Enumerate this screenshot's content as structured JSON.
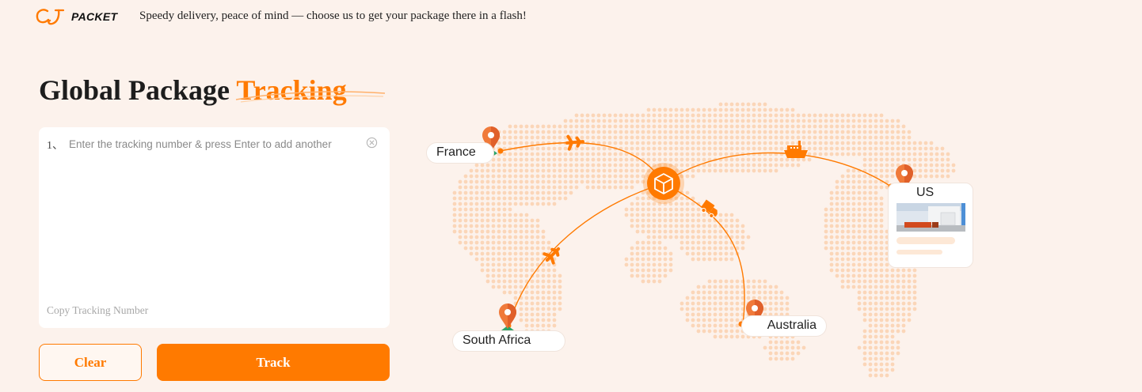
{
  "header": {
    "logo_text": "PACKET",
    "logo_icon": "cj-logo-icon",
    "tagline": "Speedy delivery, peace of mind — choose us to get your package there in a flash!"
  },
  "hero": {
    "title_main": "Global Package",
    "title_accent": "Tracking"
  },
  "tracking_form": {
    "line_number": "1、",
    "input_value": "",
    "input_placeholder": "Enter the tracking number & press Enter to add another",
    "copy_link": "Copy Tracking Number",
    "clear_icon": "circle-x-icon"
  },
  "actions": {
    "clear_label": "Clear",
    "track_label": "Track"
  },
  "map": {
    "locations": {
      "france": "France",
      "south_africa": "South Africa",
      "australia": "Australia",
      "us": "US"
    },
    "icons": [
      "package-hub-icon",
      "airplane-icon",
      "ship-icon",
      "truck-icon",
      "location-pin-icon"
    ]
  },
  "colors": {
    "accent": "#ff7a00",
    "background": "#fcf2ec",
    "dots": "#fbd6b8",
    "pin_base": "#2aa56b"
  }
}
